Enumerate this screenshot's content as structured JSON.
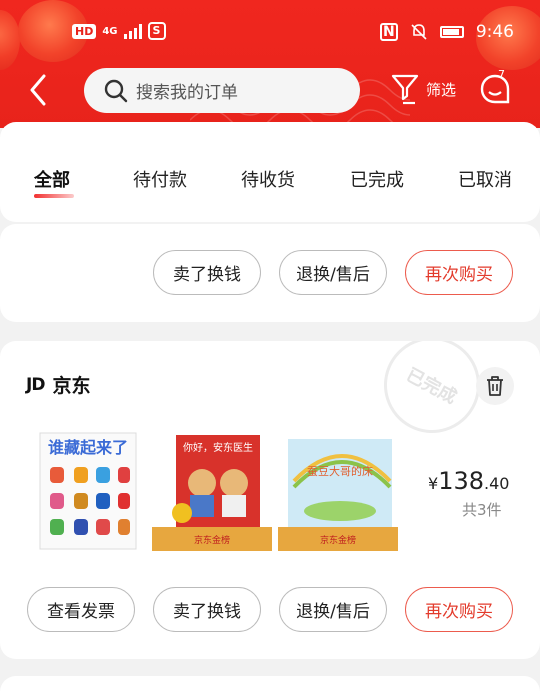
{
  "status_bar": {
    "hd_label": "HD",
    "network": "4G",
    "time": "9:46"
  },
  "header": {
    "search_placeholder": "搜索我的订单",
    "filter_label": "筛选",
    "message_count": "7"
  },
  "tabs": [
    {
      "label": "全部",
      "active": true
    },
    {
      "label": "待付款",
      "active": false
    },
    {
      "label": "待收货",
      "active": false
    },
    {
      "label": "已完成",
      "active": false
    },
    {
      "label": "已取消",
      "active": false
    }
  ],
  "order_partial": {
    "buttons": [
      "卖了换钱",
      "退换/售后",
      "再次购买"
    ]
  },
  "order": {
    "shop_logo": "JD",
    "shop_name": "京东",
    "status_stamp": "已完成",
    "products": [
      {
        "title": "谁藏起来了",
        "icon": "book-cover"
      },
      {
        "title": "你好，安东医生",
        "icon": "book-cover"
      },
      {
        "title": "蚕豆大哥的床",
        "icon": "book-cover"
      }
    ],
    "product_banner_text": "京东金榜",
    "price_symbol": "¥",
    "price_int": "138",
    "price_dec": ".40",
    "item_count": "共3件",
    "buttons": [
      "查看发票",
      "卖了换钱",
      "退换/售后",
      "再次购买"
    ]
  },
  "colors": {
    "brand_red": "#e8231b",
    "accent_red": "#e33b2c"
  }
}
